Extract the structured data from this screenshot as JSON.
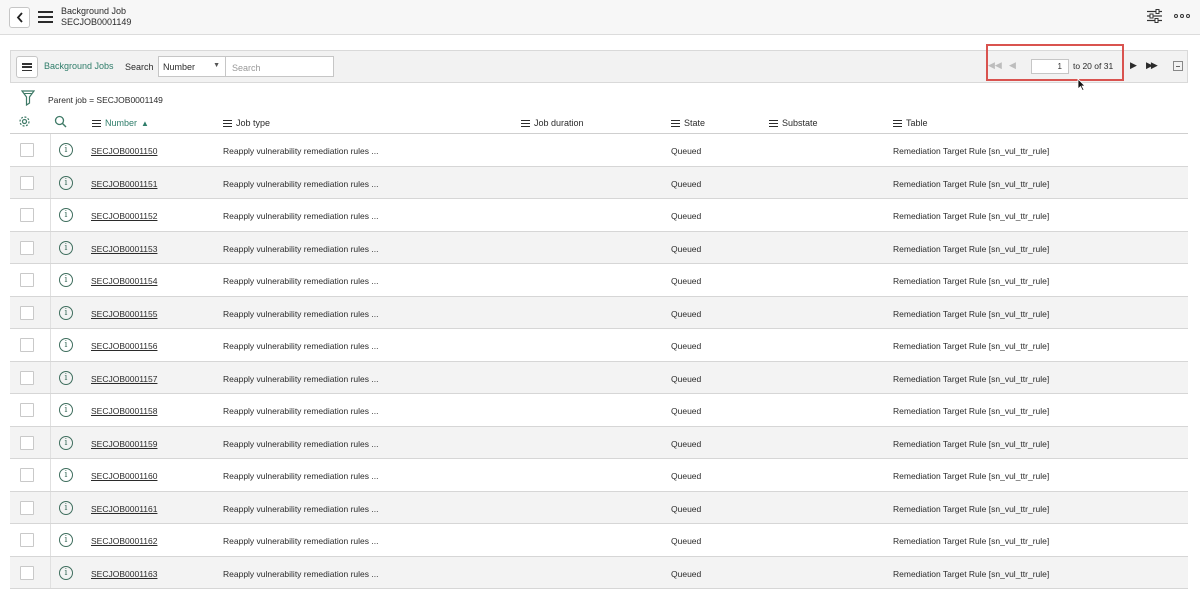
{
  "header": {
    "title": "Background Job",
    "subtitle": "SECJOB0001149"
  },
  "list": {
    "title": "Background Jobs",
    "search_label": "Search",
    "search_field": "Number",
    "search_placeholder": "Search"
  },
  "pager": {
    "current": "1",
    "range_text": "to 20 of 31"
  },
  "breadcrumb": "Parent job = SECJOB0001149",
  "columns": {
    "number": "Number",
    "job_type": "Job type",
    "job_duration": "Job duration",
    "state": "State",
    "substate": "Substate",
    "table": "Table"
  },
  "rows": [
    {
      "number": "SECJOB0001150",
      "job_type": "Reapply vulnerability remediation rules ...",
      "state": "Queued",
      "table": "Remediation Target Rule [sn_vul_ttr_rule]"
    },
    {
      "number": "SECJOB0001151",
      "job_type": "Reapply vulnerability remediation rules ...",
      "state": "Queued",
      "table": "Remediation Target Rule [sn_vul_ttr_rule]"
    },
    {
      "number": "SECJOB0001152",
      "job_type": "Reapply vulnerability remediation rules ...",
      "state": "Queued",
      "table": "Remediation Target Rule [sn_vul_ttr_rule]"
    },
    {
      "number": "SECJOB0001153",
      "job_type": "Reapply vulnerability remediation rules ...",
      "state": "Queued",
      "table": "Remediation Target Rule [sn_vul_ttr_rule]"
    },
    {
      "number": "SECJOB0001154",
      "job_type": "Reapply vulnerability remediation rules ...",
      "state": "Queued",
      "table": "Remediation Target Rule [sn_vul_ttr_rule]"
    },
    {
      "number": "SECJOB0001155",
      "job_type": "Reapply vulnerability remediation rules ...",
      "state": "Queued",
      "table": "Remediation Target Rule [sn_vul_ttr_rule]"
    },
    {
      "number": "SECJOB0001156",
      "job_type": "Reapply vulnerability remediation rules ...",
      "state": "Queued",
      "table": "Remediation Target Rule [sn_vul_ttr_rule]"
    },
    {
      "number": "SECJOB0001157",
      "job_type": "Reapply vulnerability remediation rules ...",
      "state": "Queued",
      "table": "Remediation Target Rule [sn_vul_ttr_rule]"
    },
    {
      "number": "SECJOB0001158",
      "job_type": "Reapply vulnerability remediation rules ...",
      "state": "Queued",
      "table": "Remediation Target Rule [sn_vul_ttr_rule]"
    },
    {
      "number": "SECJOB0001159",
      "job_type": "Reapply vulnerability remediation rules ...",
      "state": "Queued",
      "table": "Remediation Target Rule [sn_vul_ttr_rule]"
    },
    {
      "number": "SECJOB0001160",
      "job_type": "Reapply vulnerability remediation rules ...",
      "state": "Queued",
      "table": "Remediation Target Rule [sn_vul_ttr_rule]"
    },
    {
      "number": "SECJOB0001161",
      "job_type": "Reapply vulnerability remediation rules ...",
      "state": "Queued",
      "table": "Remediation Target Rule [sn_vul_ttr_rule]"
    },
    {
      "number": "SECJOB0001162",
      "job_type": "Reapply vulnerability remediation rules ...",
      "state": "Queued",
      "table": "Remediation Target Rule [sn_vul_ttr_rule]"
    },
    {
      "number": "SECJOB0001163",
      "job_type": "Reapply vulnerability remediation rules ...",
      "state": "Queued",
      "table": "Remediation Target Rule [sn_vul_ttr_rule]"
    }
  ],
  "colors": {
    "accent": "#2f7d6a",
    "highlight": "#d9534f"
  }
}
